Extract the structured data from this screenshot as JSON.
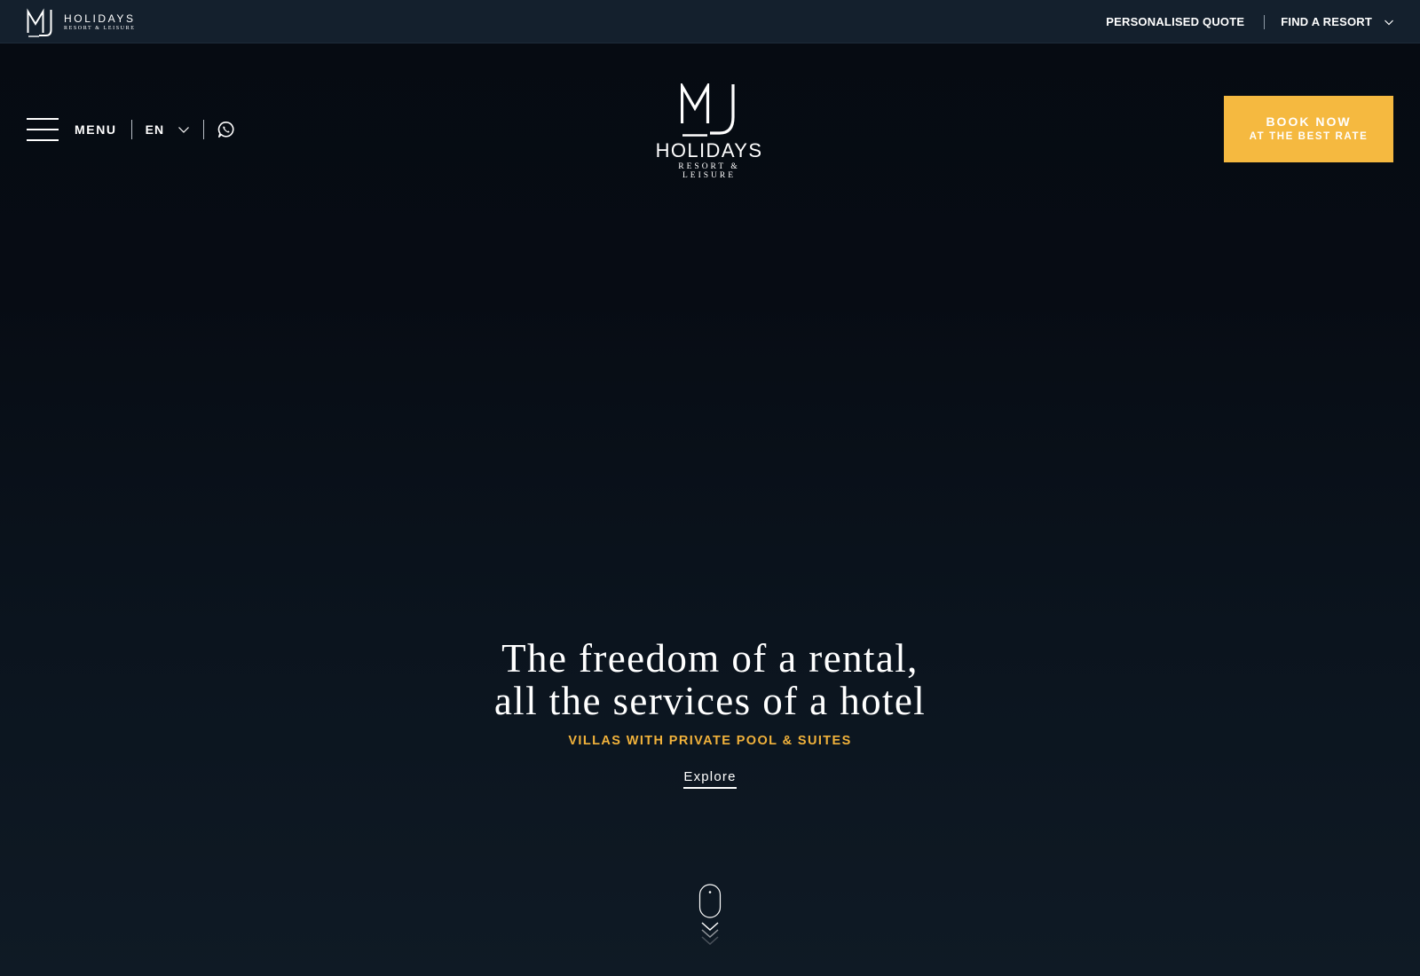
{
  "brand": {
    "name": "HOLIDAYS",
    "tagline": "RESORT & LEISURE",
    "monogram": "MJ"
  },
  "topbar": {
    "personalised_quote": "PERSONALISED QUOTE",
    "find_resort": "FIND A RESORT"
  },
  "header": {
    "menu_label": "MENU",
    "language": "EN",
    "book_now": "BOOK NOW",
    "book_now_sub": "AT THE BEST RATE"
  },
  "hero": {
    "line1": "The freedom of a rental,",
    "line2": "all the services of a hotel",
    "subtitle": "VILLAS WITH PRIVATE POOL & SUITES",
    "cta": "Explore"
  },
  "icons": {
    "menu": "hamburger-icon",
    "language_dropdown": "chevron-down-icon",
    "contact": "whatsapp-icon",
    "scroll": "mouse-scroll-icon"
  },
  "colors": {
    "accent": "#f5b940",
    "subtitle": "#f1b23b",
    "topbar_bg": "#14202d",
    "page_bg": "#070c14"
  }
}
